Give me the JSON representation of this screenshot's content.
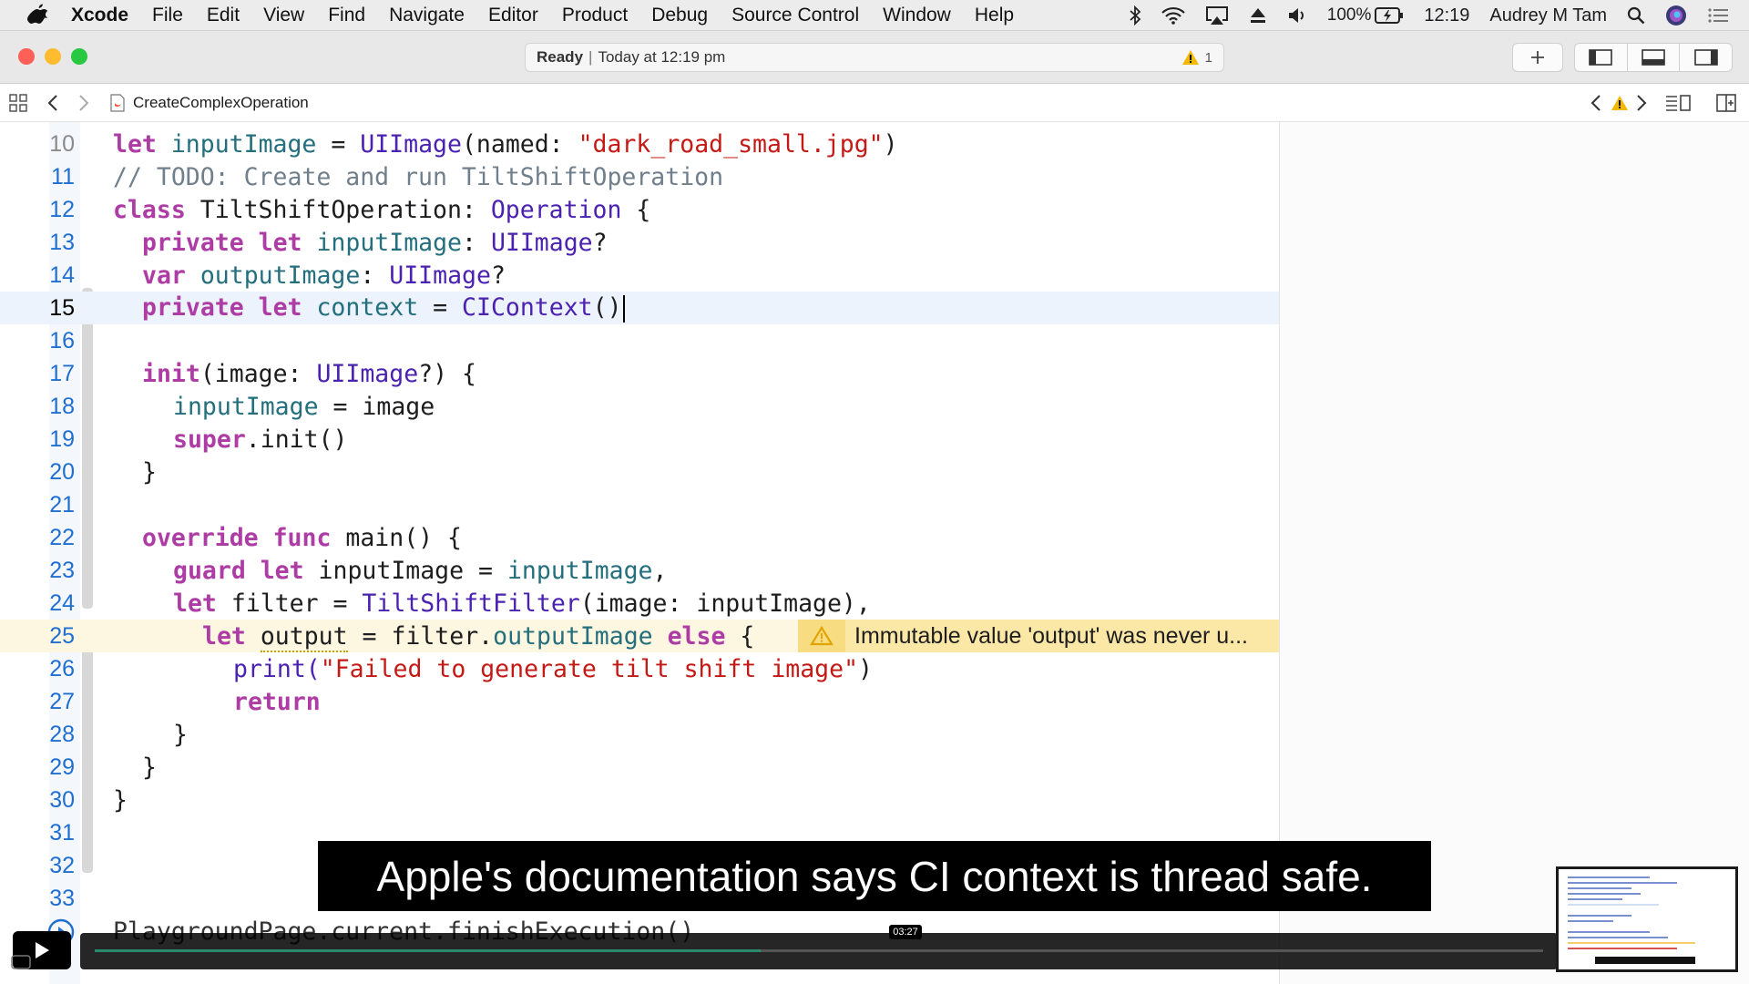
{
  "menubar": {
    "app_name": "Xcode",
    "items": [
      "File",
      "Edit",
      "View",
      "Find",
      "Navigate",
      "Editor",
      "Product",
      "Debug",
      "Source Control",
      "Window",
      "Help"
    ],
    "battery": "100%",
    "time": "12:19",
    "user": "Audrey M Tam"
  },
  "toolbar": {
    "status_ready": "Ready",
    "status_time": "Today at 12:19 pm",
    "warning_count": "1"
  },
  "jumpbar": {
    "file_name": "CreateComplexOperation"
  },
  "code_lines": [
    {
      "n": "10"
    },
    {
      "n": "11"
    },
    {
      "n": "12"
    },
    {
      "n": "13"
    },
    {
      "n": "14"
    },
    {
      "n": "15"
    },
    {
      "n": "16"
    },
    {
      "n": "17"
    },
    {
      "n": "18"
    },
    {
      "n": "19"
    },
    {
      "n": "20"
    },
    {
      "n": "21"
    },
    {
      "n": "22"
    },
    {
      "n": "23"
    },
    {
      "n": "24"
    },
    {
      "n": "25"
    },
    {
      "n": "26"
    },
    {
      "n": "27"
    },
    {
      "n": "28"
    },
    {
      "n": "29"
    },
    {
      "n": "30"
    },
    {
      "n": "31"
    },
    {
      "n": "32"
    },
    {
      "n": "33"
    }
  ],
  "code": {
    "l10": [
      "let",
      " ",
      "inputImage",
      " = ",
      "UIImage",
      "(named: ",
      "\"dark_road_small.jpg\"",
      ")"
    ],
    "l11": "// TODO: Create and run TiltShiftOperation",
    "l12": [
      "class",
      " TiltShiftOperation: ",
      "Operation",
      " {"
    ],
    "l13": [
      "private let",
      " ",
      "inputImage",
      ": ",
      "UIImage",
      "?"
    ],
    "l14": [
      "var",
      " ",
      "outputImage",
      ": ",
      "UIImage",
      "?"
    ],
    "l15": [
      "private let",
      " ",
      "context",
      " = ",
      "CIContext",
      "()"
    ],
    "l17": [
      "init",
      "(image: ",
      "UIImage",
      "?) {"
    ],
    "l18": [
      "inputImage",
      " = image"
    ],
    "l19": [
      "super",
      ".init()"
    ],
    "l20": "}",
    "l22": [
      "override func",
      " main() {"
    ],
    "l23": [
      "guard let",
      " inputImage = ",
      "inputImage",
      ","
    ],
    "l24": [
      "let",
      " filter = ",
      "TiltShiftFilter",
      "(image: inputImage),"
    ],
    "l25": [
      "let",
      " ",
      "output",
      " = filter.",
      "outputImage",
      " ",
      "else",
      " {"
    ],
    "l26": [
      "print(",
      "\"Failed to generate tilt shift image\"",
      ")"
    ],
    "l27": "return",
    "l28": "}",
    "l29": "}",
    "l30": "}",
    "l33": "PlaygroundPage.current.finishExecution()"
  },
  "inline_warning": "Immutable value 'output' was never u...",
  "caption": "Apple's documentation says CI context is thread safe.",
  "video": {
    "time": "03:27",
    "progress": 0.46
  },
  "colors": {
    "keyword": "#ad3da4",
    "type": "#4b21b0",
    "variable": "#236f7d",
    "string": "#c41a16",
    "comment": "#707f8c",
    "line_number": "#1f6fd1",
    "warning_bg": "#fbe7a6"
  }
}
